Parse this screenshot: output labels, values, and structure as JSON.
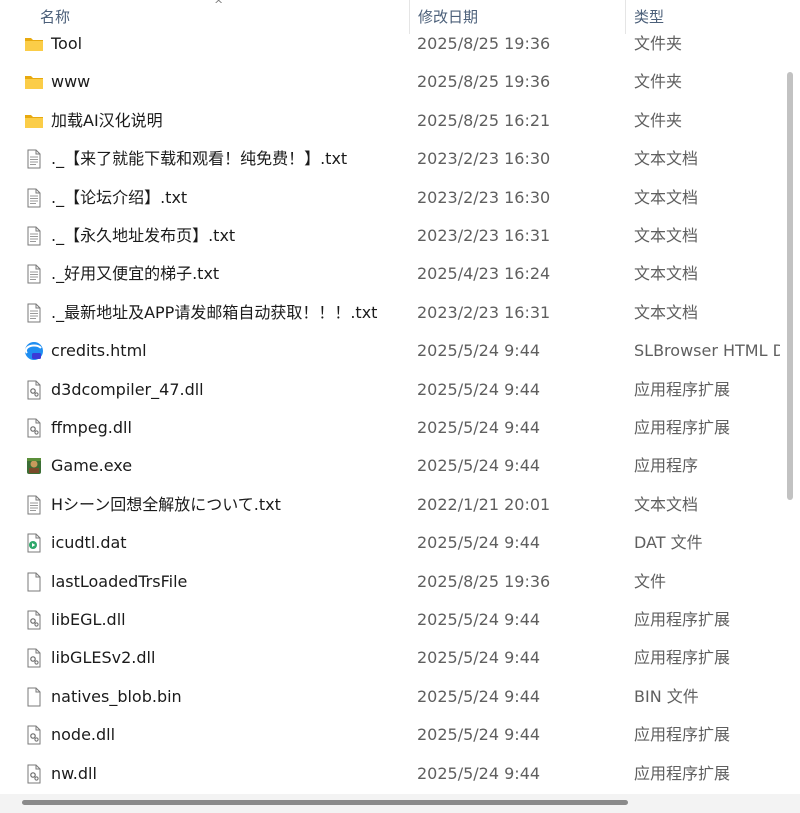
{
  "columns": {
    "name": "名称",
    "date": "修改日期",
    "type": "类型"
  },
  "files": [
    {
      "name": "Tool",
      "date": "2025/8/25 19:36",
      "type": "文件夹",
      "icon": "folder-icon"
    },
    {
      "name": "www",
      "date": "2025/8/25 19:36",
      "type": "文件夹",
      "icon": "folder-icon"
    },
    {
      "name": "加载AI汉化说明",
      "date": "2025/8/25 16:21",
      "type": "文件夹",
      "icon": "folder-icon"
    },
    {
      "name": "._【来了就能下载和观看！纯免费！】.txt",
      "date": "2023/2/23 16:30",
      "type": "文本文档",
      "icon": "text-file-icon"
    },
    {
      "name": "._【论坛介绍】.txt",
      "date": "2023/2/23 16:30",
      "type": "文本文档",
      "icon": "text-file-icon"
    },
    {
      "name": "._【永久地址发布页】.txt",
      "date": "2023/2/23 16:31",
      "type": "文本文档",
      "icon": "text-file-icon"
    },
    {
      "name": "._好用又便宜的梯子.txt",
      "date": "2025/4/23 16:24",
      "type": "文本文档",
      "icon": "text-file-icon"
    },
    {
      "name": "._最新地址及APP请发邮箱自动获取！！！.txt",
      "date": "2023/2/23 16:31",
      "type": "文本文档",
      "icon": "text-file-icon"
    },
    {
      "name": "credits.html",
      "date": "2025/5/24 9:44",
      "type": "SLBrowser HTML D",
      "icon": "browser-html-icon"
    },
    {
      "name": "d3dcompiler_47.dll",
      "date": "2025/5/24 9:44",
      "type": "应用程序扩展",
      "icon": "dll-file-icon"
    },
    {
      "name": "ffmpeg.dll",
      "date": "2025/5/24 9:44",
      "type": "应用程序扩展",
      "icon": "dll-file-icon"
    },
    {
      "name": "Game.exe",
      "date": "2025/5/24 9:44",
      "type": "应用程序",
      "icon": "game-exe-icon"
    },
    {
      "name": "Hシーン回想全解放について.txt",
      "date": "2022/1/21 20:01",
      "type": "文本文档",
      "icon": "text-file-icon"
    },
    {
      "name": "icudtl.dat",
      "date": "2025/5/24 9:44",
      "type": "DAT 文件",
      "icon": "media-file-icon"
    },
    {
      "name": "lastLoadedTrsFile",
      "date": "2025/8/25 19:36",
      "type": "文件",
      "icon": "blank-file-icon"
    },
    {
      "name": "libEGL.dll",
      "date": "2025/5/24 9:44",
      "type": "应用程序扩展",
      "icon": "dll-file-icon"
    },
    {
      "name": "libGLESv2.dll",
      "date": "2025/5/24 9:44",
      "type": "应用程序扩展",
      "icon": "dll-file-icon"
    },
    {
      "name": "natives_blob.bin",
      "date": "2025/5/24 9:44",
      "type": "BIN 文件",
      "icon": "blank-file-icon"
    },
    {
      "name": "node.dll",
      "date": "2025/5/24 9:44",
      "type": "应用程序扩展",
      "icon": "dll-file-icon"
    },
    {
      "name": "nw.dll",
      "date": "2025/5/24 9:44",
      "type": "应用程序扩展",
      "icon": "dll-file-icon"
    }
  ],
  "colors": {
    "header_text": "#4c607a",
    "folder": "#f8c43a",
    "scroll_thumb": "#8a8a8a"
  }
}
